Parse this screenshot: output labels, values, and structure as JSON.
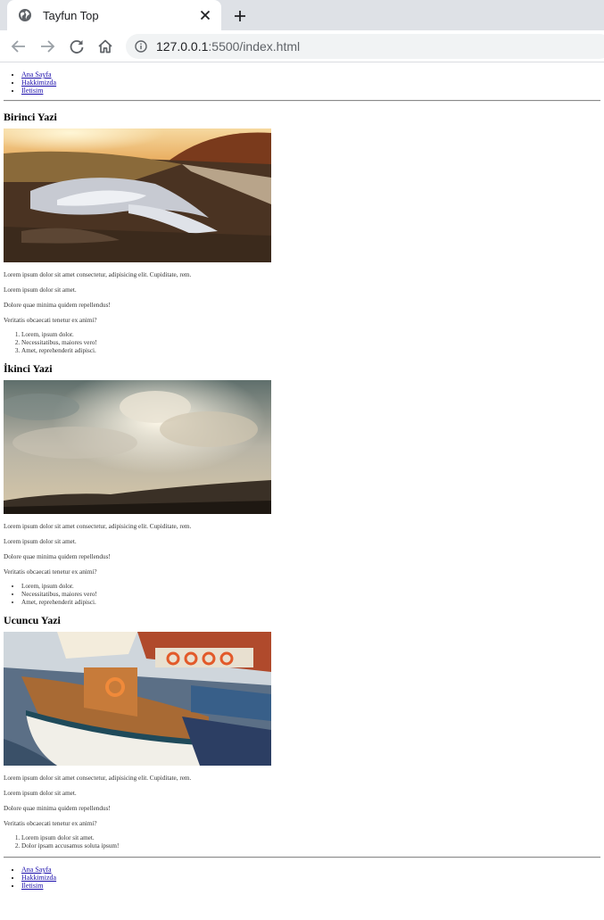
{
  "browser": {
    "tab_title": "Tayfun Top",
    "url_host": "127.0.0.1",
    "url_path": ":5500/index.html"
  },
  "nav": {
    "items": [
      {
        "label": "Ana Sayfa"
      },
      {
        "label": "Hakkimizda"
      },
      {
        "label": "Iletisim"
      }
    ]
  },
  "posts": [
    {
      "title": "Birinci Yazi",
      "image": "sunset-muddy-road-photo",
      "paragraphs": [
        "Lorem ipsum dolor sit amet consectetur, adipisicing elit. Cupiditate, rem.",
        "Lorem ipsum dolor sit amet.",
        "Dolore quae minima quidem repellendus!",
        "Veritatis obcaecati tenetur ex animi?"
      ],
      "list_type": "ordered",
      "list": [
        "Lorem, ipsum dolor.",
        "Necessitatibus, maiores vero!",
        "Amet, reprehenderit adipisci."
      ]
    },
    {
      "title": "İkinci Yazi",
      "image": "cloudy-sky-landscape-photo",
      "paragraphs": [
        "Lorem ipsum dolor sit amet consectetur, adipisicing elit. Cupiditate, rem.",
        "Lorem ipsum dolor sit amet.",
        "Dolore quae minima quidem repellendus!",
        "Veritatis obcaecati tenetur ex animi?"
      ],
      "list_type": "unordered",
      "list": [
        "Lorem, ipsum dolor.",
        "Necessitatibus, maiores vero!",
        "Amet, reprehenderit adipisci."
      ]
    },
    {
      "title": "Ucuncu Yazi",
      "image": "boat-harbor-photo",
      "paragraphs": [
        "Lorem ipsum dolor sit amet consectetur, adipisicing elit. Cupiditate, rem.",
        "Lorem ipsum dolor sit amet.",
        "Dolore quae minima quidem repellendus!",
        "Veritatis obcaecati tenetur ex animi?"
      ],
      "list_type": "ordered",
      "list": [
        "Lorem ipsum dolor sit amet.",
        "Dolor ipsam accusamus soluta ipsum!"
      ]
    }
  ],
  "footer_nav": {
    "items": [
      {
        "label": "Ana Sayfa"
      },
      {
        "label": "Hakkimizda"
      },
      {
        "label": "Iletisim"
      }
    ]
  },
  "colors": {
    "tabbar": "#dee1e6",
    "link": "#1a0dab",
    "omnibox": "#f1f3f4"
  }
}
